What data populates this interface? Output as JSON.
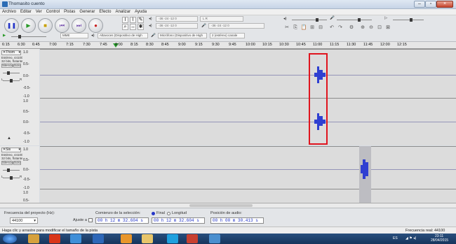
{
  "window": {
    "title": "Thomasito cuento"
  },
  "menu": [
    "Archivo",
    "Editar",
    "Ver",
    "Control",
    "Pistas",
    "Generar",
    "Efecto",
    "Analizar",
    "Ayuda"
  ],
  "toolbar": {
    "transport": [
      "pause",
      "play",
      "stop",
      "skip-start",
      "skip-end",
      "record"
    ],
    "playback_device": "Altavoces (Dispositivo de High",
    "record_device": "Micrófono (Dispositivo de High",
    "channels": "2 (estéreo) canale",
    "host": "MME",
    "meter_scale": "-36  -24  -12  0",
    "meter_scale_rec": "-36  -24  -12  0"
  },
  "ruler": {
    "ticks": [
      "6:15",
      "6:30",
      "6:45",
      "7:00",
      "7:15",
      "7:30",
      "7:45",
      "8:00",
      "8:15",
      "8:30",
      "8:45",
      "9:00",
      "9:15",
      "9:30",
      "9:45",
      "10:00",
      "10:15",
      "10:30",
      "10:45",
      "11:00",
      "11:15",
      "11:30",
      "11:45",
      "12:00",
      "12:15"
    ]
  },
  "tracks": [
    {
      "name": "Thom",
      "info": [
        "Estéreo, 44100Hz",
        "32 bits, flotante"
      ],
      "mute": "Silencio",
      "solo": "Solo",
      "scale": [
        "1.0",
        "0.5-",
        "0.0-",
        "-0.5-",
        "-1.0",
        "1.0",
        "0.5-",
        "0.0-",
        "-0.5-",
        "-1.0"
      ]
    },
    {
      "name": "Sis",
      "info": [
        "Estéreo, 44100Hz",
        "32 bits, flotante"
      ],
      "mute": "Silencio",
      "solo": "Solo",
      "scale": [
        "1.0",
        "0.5-",
        "0.0-",
        "-0.5-",
        "-1.0",
        "1.0",
        "0.5-"
      ]
    }
  ],
  "selection": {
    "rate_label": "Frecuencia del proyecto (Hz):",
    "rate_value": "44100",
    "snap_label": "Ajuste a",
    "start_label": "Comienzo de la selección:",
    "end_option": "Final",
    "length_option": "Longitud",
    "audio_pos_label": "Posición de audio:",
    "start_value": "00 h 12 m 32.604 s",
    "end_value": "00 h 12 m 32.604 s",
    "audio_pos_value": "00 h 00 m 30.413 s"
  },
  "status": {
    "left": "Haga clic y arrastre para modificar el tamaño de la pista",
    "right": "Frecuencia real: 44100"
  },
  "taskbar": {
    "lang": "ES",
    "time": "23:11",
    "date": "28/04/2015"
  }
}
